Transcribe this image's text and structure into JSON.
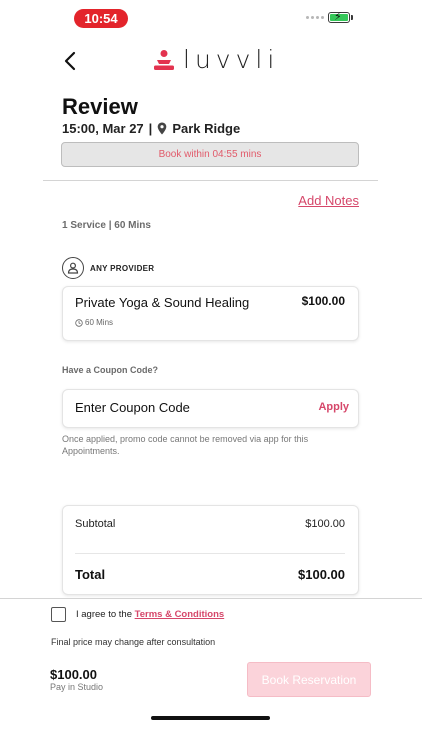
{
  "status_bar": {
    "time": "10:54"
  },
  "brand": {
    "name": "luvvli",
    "accent": "#d6476a",
    "logo_color": "#e3334f"
  },
  "page": {
    "title": "Review"
  },
  "appointment": {
    "datetime": "15:00, Mar 27",
    "separator": "|",
    "location": "Park Ridge"
  },
  "countdown": {
    "text": "Book within 04:55 mins"
  },
  "notes": {
    "label": "Add Notes"
  },
  "summary": {
    "text": "1 Service | 60 Mins"
  },
  "provider": {
    "label": "ANY PROVIDER"
  },
  "service": {
    "name": "Private Yoga & Sound Healing",
    "price": "$100.00",
    "duration": "60 Mins"
  },
  "coupon": {
    "heading": "Have a Coupon Code?",
    "placeholder": "Enter Coupon Code",
    "apply_label": "Apply",
    "note": "Once applied, promo code cannot be removed via app for this Appointments."
  },
  "totals": {
    "subtotal_label": "Subtotal",
    "subtotal_value": "$100.00",
    "total_label": "Total",
    "total_value": "$100.00"
  },
  "terms": {
    "prefix": "I agree to the",
    "link": "Terms & Conditions",
    "checked": false
  },
  "price_note": "Final price may change after consultation",
  "footer": {
    "price": "$100.00",
    "payment_note": "Pay in Studio",
    "book_label": "Book Reservation"
  }
}
